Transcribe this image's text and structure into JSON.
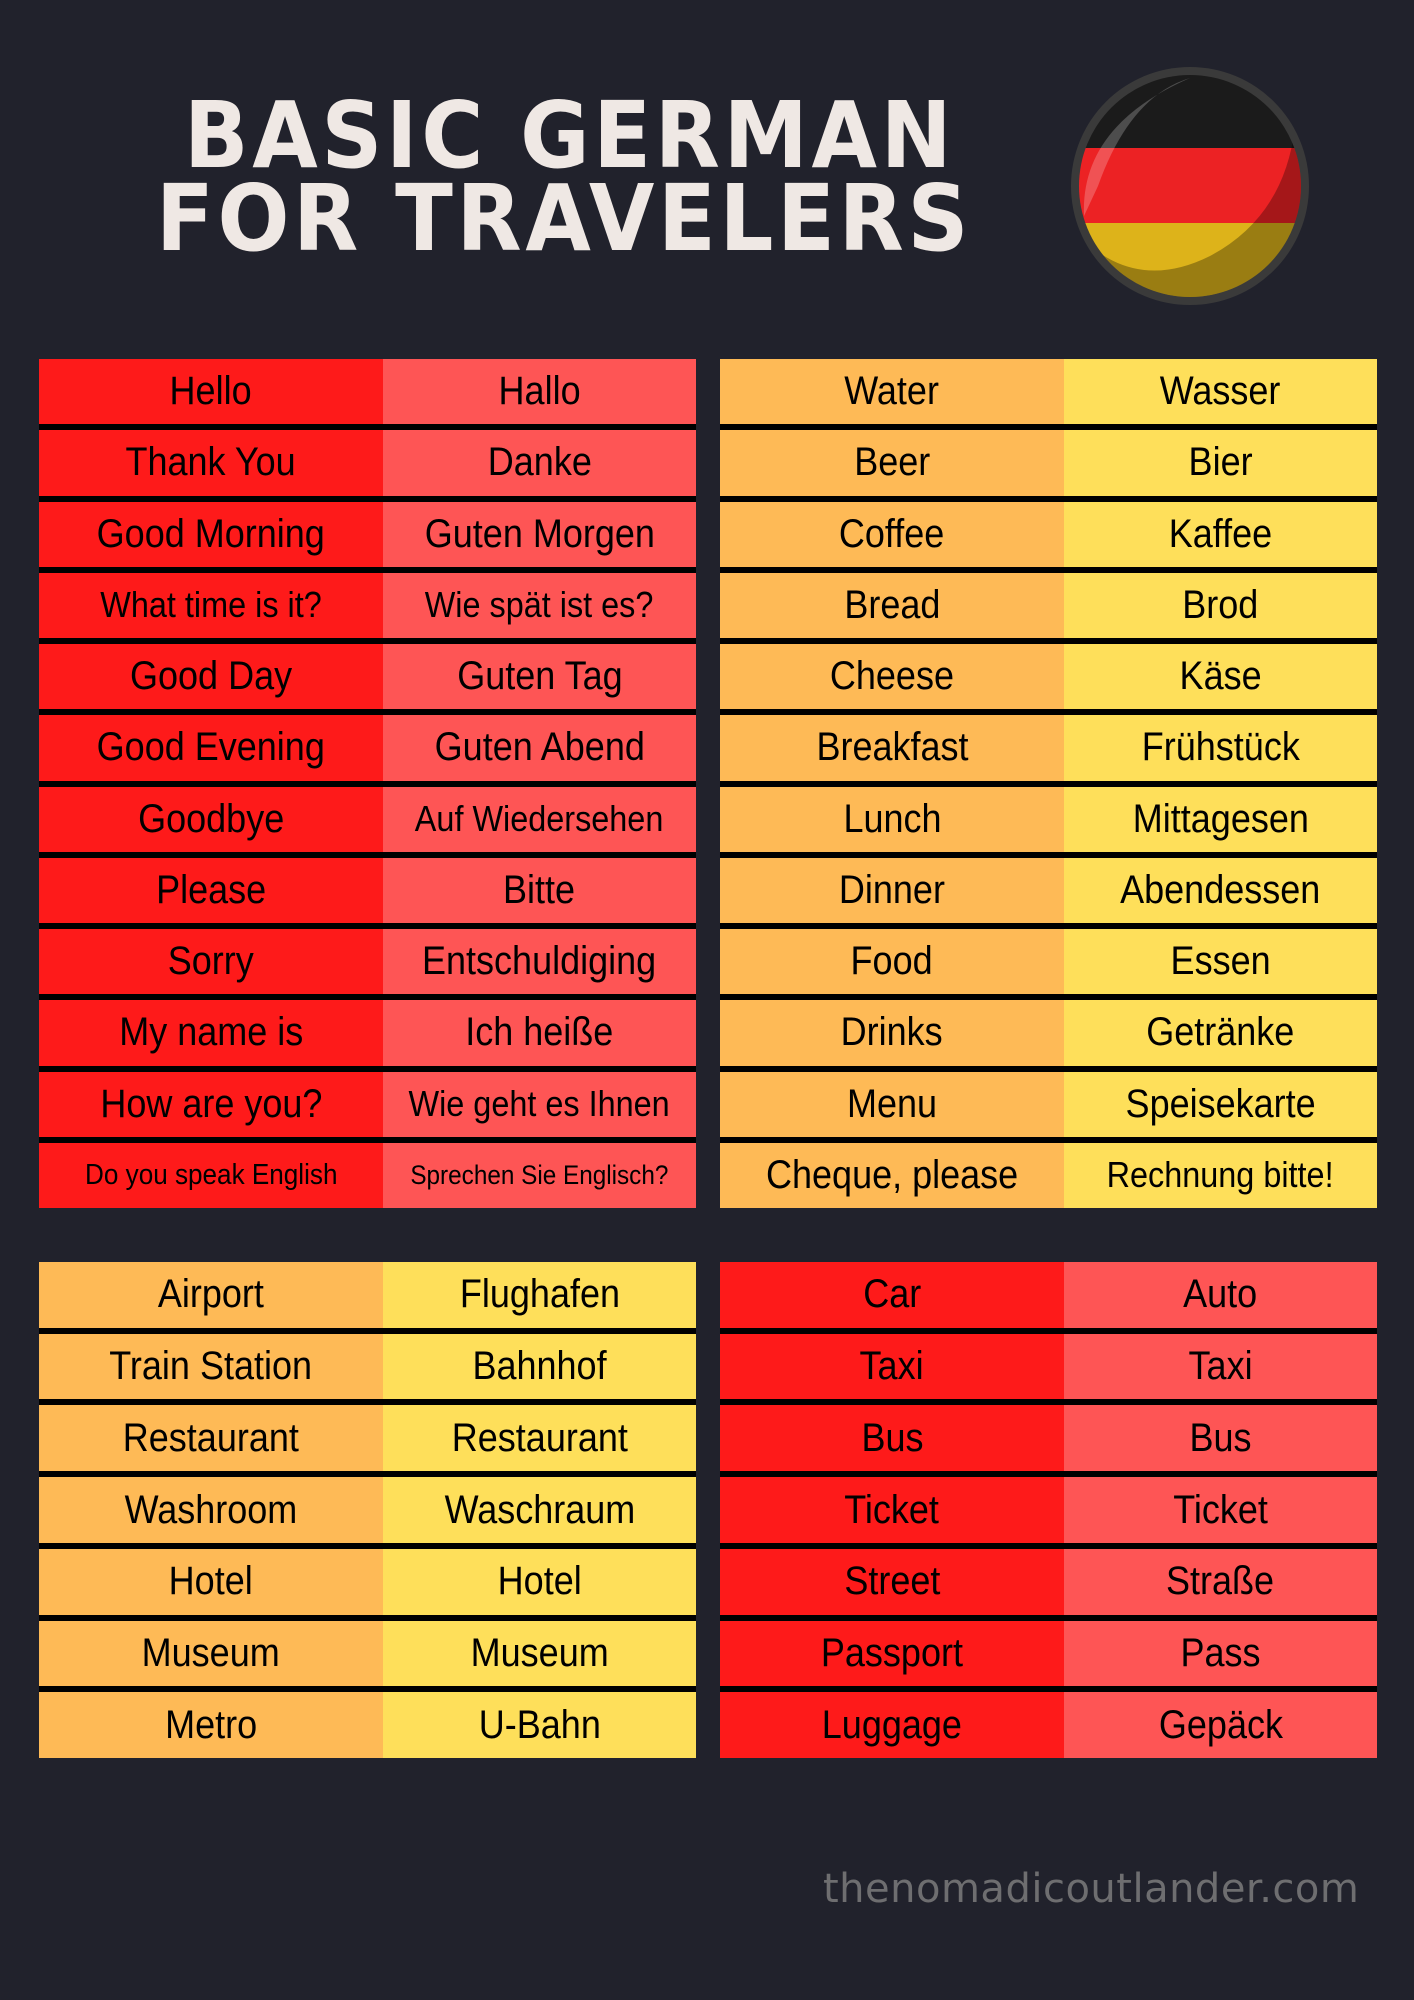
{
  "header": {
    "title_line1": "BASIC GERMAN",
    "title_line2": "FOR TRAVELERS",
    "flag_icon": "germany-flag-badge",
    "flag_colors": [
      "#1b1b1b",
      "#ec2224",
      "#ddb31a"
    ]
  },
  "colors": {
    "background": "#21222c",
    "red_en": "#fe1a1a",
    "red_de": "#fe5555",
    "yellow_en": "#feba56",
    "yellow_de": "#fedf5a",
    "divider": "#000000"
  },
  "panels": [
    {
      "theme": "red",
      "rows": [
        {
          "en": "Hello",
          "de": "Hallo"
        },
        {
          "en": "Thank You",
          "de": "Danke"
        },
        {
          "en": "Good Morning",
          "de": "Guten Morgen"
        },
        {
          "en": "What time is it?",
          "de": "Wie spät ist es?"
        },
        {
          "en": "Good Day",
          "de": "Guten Tag"
        },
        {
          "en": "Good Evening",
          "de": "Guten Abend"
        },
        {
          "en": "Goodbye",
          "de": "Auf Wiedersehen"
        },
        {
          "en": "Please",
          "de": "Bitte"
        },
        {
          "en": "Sorry",
          "de": "Entschuldiging"
        },
        {
          "en": "My name is",
          "de": "Ich heiße"
        },
        {
          "en": "How are you?",
          "de": "Wie geht es Ihnen"
        },
        {
          "en": "Do you speak English",
          "de": "Sprechen Sie Englisch?"
        }
      ]
    },
    {
      "theme": "yellow",
      "rows": [
        {
          "en": "Water",
          "de": "Wasser"
        },
        {
          "en": "Beer",
          "de": "Bier"
        },
        {
          "en": "Coffee",
          "de": "Kaffee"
        },
        {
          "en": "Bread",
          "de": "Brod"
        },
        {
          "en": "Cheese",
          "de": "Käse"
        },
        {
          "en": "Breakfast",
          "de": "Frühstück"
        },
        {
          "en": "Lunch",
          "de": "Mittagesen"
        },
        {
          "en": "Dinner",
          "de": "Abendessen"
        },
        {
          "en": "Food",
          "de": "Essen"
        },
        {
          "en": "Drinks",
          "de": "Getränke"
        },
        {
          "en": "Menu",
          "de": "Speisekarte"
        },
        {
          "en": "Cheque, please",
          "de": "Rechnung bitte!"
        }
      ]
    },
    {
      "theme": "yellow",
      "rows": [
        {
          "en": "Airport",
          "de": "Flughafen"
        },
        {
          "en": "Train Station",
          "de": "Bahnhof"
        },
        {
          "en": "Restaurant",
          "de": "Restaurant"
        },
        {
          "en": "Washroom",
          "de": "Waschraum"
        },
        {
          "en": "Hotel",
          "de": "Hotel"
        },
        {
          "en": "Museum",
          "de": "Museum"
        },
        {
          "en": "Metro",
          "de": "U-Bahn"
        }
      ]
    },
    {
      "theme": "red",
      "rows": [
        {
          "en": "Car",
          "de": "Auto"
        },
        {
          "en": "Taxi",
          "de": "Taxi"
        },
        {
          "en": "Bus",
          "de": "Bus"
        },
        {
          "en": "Ticket",
          "de": "Ticket"
        },
        {
          "en": "Street",
          "de": "Straße"
        },
        {
          "en": "Passport",
          "de": "Pass"
        },
        {
          "en": "Luggage",
          "de": "Gepäck"
        }
      ]
    }
  ],
  "footer": {
    "website": "thenomadicoutlander.com"
  }
}
